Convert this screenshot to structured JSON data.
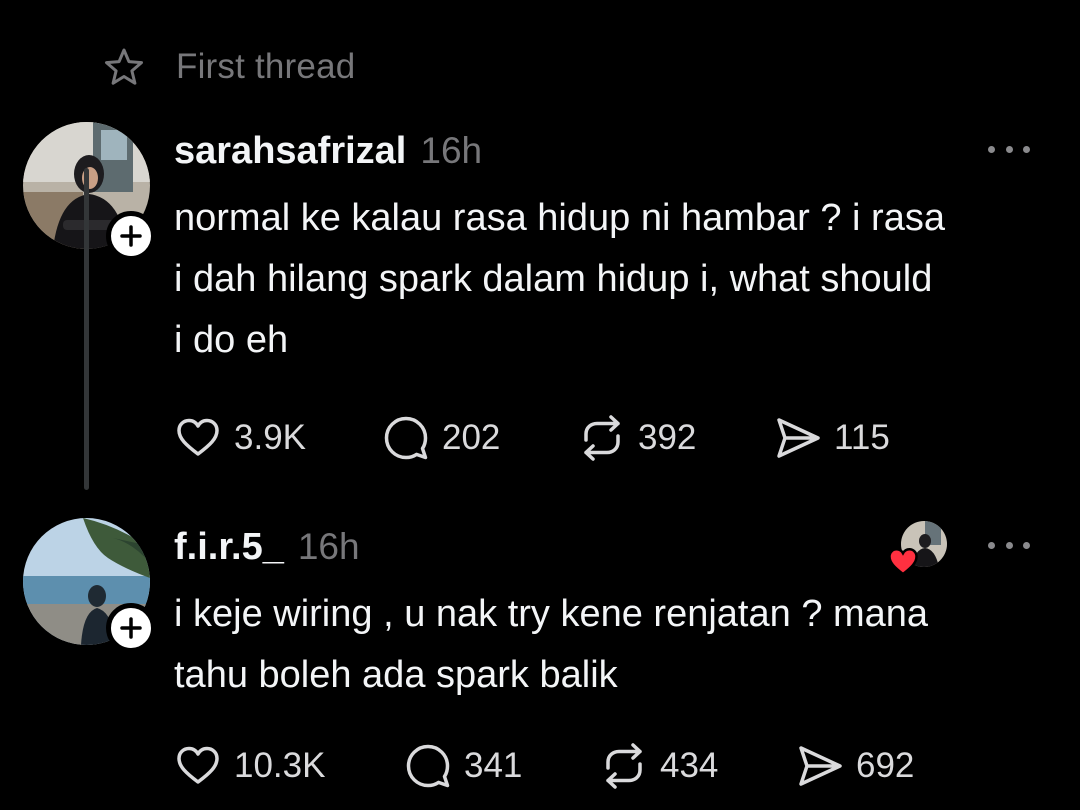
{
  "header": {
    "label": "First thread",
    "icon": "star-icon"
  },
  "posts": [
    {
      "username": "sarahsafrizal",
      "time": "16h",
      "text_lines": [
        "normal ke kalau rasa hidup ni hambar ? i rasa",
        "i dah hilang spark dalam hidup i, what should",
        "i do eh"
      ],
      "likes": "3.9K",
      "replies": "202",
      "reposts": "392",
      "shares": "115"
    },
    {
      "username": "f.i.r.5_",
      "time": "16h",
      "text_lines": [
        "i keje wiring , u nak try kene renjatan ? mana",
        "tahu boleh ada spark balik"
      ],
      "likes": "10.3K",
      "replies": "341",
      "reposts": "434",
      "shares": "692"
    }
  ],
  "colors": {
    "background": "#000000",
    "text": "#f3f5f7",
    "muted": "#77777a",
    "heart": "#ff3040"
  }
}
